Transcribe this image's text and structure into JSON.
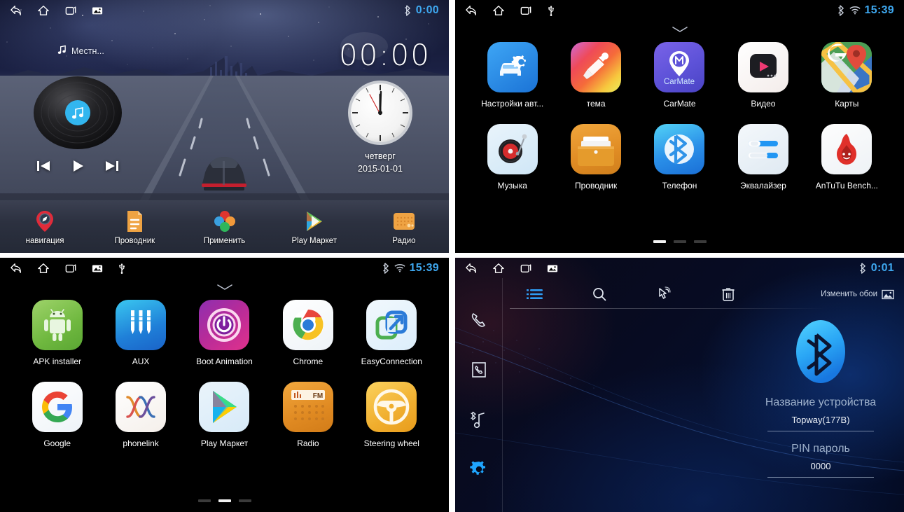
{
  "panels": {
    "home": {
      "name": "Car head unit home screen",
      "statusbar": {
        "icons": [
          "back-icon",
          "home-icon",
          "recents-icon",
          "screenshot-icon"
        ],
        "bluetooth": "bluetooth-icon",
        "time": "0:00",
        "time_color": "#3ea8f0"
      },
      "music_widget": {
        "icon": "music-note-icon",
        "source_label": "Местн...",
        "prev_label": "prev-track-icon",
        "play_label": "play-icon",
        "next_label": "next-track-icon"
      },
      "clock_widget": {
        "digital_time": "00:00",
        "weekday": "четверг",
        "date": "2015-01-01"
      },
      "dock": [
        {
          "label": "навигация",
          "icon": "navigation-pin-icon"
        },
        {
          "label": "Проводник",
          "icon": "file-manager-icon"
        },
        {
          "label": "Применить",
          "icon": "apply-flower-icon"
        },
        {
          "label": "Play Маркет",
          "icon": "play-store-icon"
        },
        {
          "label": "Радио",
          "icon": "radio-icon"
        }
      ]
    },
    "apps_page1": {
      "name": "App drawer page 1",
      "statusbar": {
        "icons": [
          "back-icon",
          "home-icon",
          "recents-icon",
          "usb-icon"
        ],
        "bluetooth": "bluetooth-icon",
        "wifi": "wifi-icon",
        "time": "15:39",
        "time_color": "#3ea8f0"
      },
      "handle": "chevron-down-icon",
      "apps": [
        {
          "label": "Настройки авт...",
          "icon": "car-settings-icon"
        },
        {
          "label": "тема",
          "icon": "theme-brush-icon"
        },
        {
          "label": "CarMate",
          "icon": "carmate-icon"
        },
        {
          "label": "Видео",
          "icon": "video-player-icon"
        },
        {
          "label": "Карты",
          "icon": "google-maps-icon"
        },
        {
          "label": "Музыка",
          "icon": "music-turntable-icon"
        },
        {
          "label": "Проводник",
          "icon": "file-explorer-icon"
        },
        {
          "label": "Телефон",
          "icon": "bluetooth-phone-icon"
        },
        {
          "label": "Эквалайзер",
          "icon": "equalizer-icon"
        },
        {
          "label": "AnTuTu Bench...",
          "icon": "antutu-icon"
        }
      ],
      "pages": {
        "count": 3,
        "active": 1
      }
    },
    "apps_page2": {
      "name": "App drawer page 2",
      "statusbar": {
        "icons": [
          "back-icon",
          "home-icon",
          "recents-icon",
          "screenshot-icon",
          "usb-icon"
        ],
        "bluetooth": "bluetooth-icon",
        "wifi": "wifi-icon",
        "time": "15:39",
        "time_color": "#3ea8f0"
      },
      "handle": "chevron-down-icon",
      "apps": [
        {
          "label": "APK installer",
          "icon": "android-robot-icon"
        },
        {
          "label": "AUX",
          "icon": "aux-jack-icon"
        },
        {
          "label": "Boot Animation",
          "icon": "power-boot-icon"
        },
        {
          "label": "Chrome",
          "icon": "chrome-icon"
        },
        {
          "label": "EasyConnection",
          "icon": "easyconnection-icon"
        },
        {
          "label": "Google",
          "icon": "google-g-icon"
        },
        {
          "label": "phonelink",
          "icon": "phonelink-icon"
        },
        {
          "label": "Play Маркет",
          "icon": "play-store-icon"
        },
        {
          "label": "Radio",
          "icon": "fm-radio-icon"
        },
        {
          "label": "Steering wheel",
          "icon": "steering-wheel-icon"
        }
      ],
      "pages": {
        "count": 3,
        "active": 2
      }
    },
    "bluetooth": {
      "name": "Bluetooth settings screen",
      "statusbar": {
        "icons": [
          "back-icon",
          "home-icon",
          "recents-icon",
          "screenshot-icon"
        ],
        "bluetooth": "bluetooth-icon",
        "time": "0:01",
        "time_color": "#3ea8f0"
      },
      "sidebar": [
        {
          "icon": "dialpad-phone-icon",
          "active": false
        },
        {
          "icon": "contacts-book-icon",
          "active": false
        },
        {
          "icon": "bluetooth-music-icon",
          "active": false
        },
        {
          "icon": "settings-gear-icon",
          "active": true
        }
      ],
      "toolbar": [
        {
          "icon": "list-icon",
          "active": true
        },
        {
          "icon": "search-icon",
          "active": false
        },
        {
          "icon": "tap-select-icon",
          "active": false
        },
        {
          "icon": "trash-icon",
          "active": false
        }
      ],
      "wallpaper_action": {
        "label": "Изменить обои",
        "icon": "image-icon"
      },
      "device": {
        "logo": "bluetooth-logo-icon",
        "name_label": "Название устройства",
        "name_value": "Topway(177B)",
        "pin_label": "PIN пароль",
        "pin_value": "0000"
      },
      "accent_color": "#29a8ff"
    }
  }
}
